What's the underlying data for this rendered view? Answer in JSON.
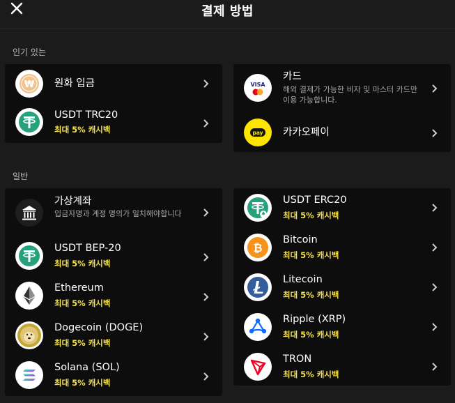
{
  "header": {
    "title": "결제 방법"
  },
  "sections": {
    "popular": "인기 있는",
    "general": "일반"
  },
  "cashback": "최대 5% 캐시백",
  "popular_left": [
    {
      "name": "원화 입금",
      "icon": "won-coin-icon"
    },
    {
      "name": "USDT TRC20",
      "icon": "tether-icon"
    }
  ],
  "popular_right": [
    {
      "name": "카드",
      "desc": "해외 결제가 가능한 비자 및 마스터 카드만 이용 가능합니다.",
      "icon": "visa-mastercard-icon",
      "visa": "VISA"
    },
    {
      "name": "카카오페이",
      "icon": "kakaopay-icon",
      "badge": "pay"
    }
  ],
  "general_left": [
    {
      "name": "가상계좌",
      "desc": "입금자명과 계정 명의가 일치해야합니다",
      "icon": "bank-icon"
    },
    {
      "name": "USDT BEP-20",
      "icon": "tether-icon"
    },
    {
      "name": "Ethereum",
      "icon": "ethereum-icon"
    },
    {
      "name": "Dogecoin (DOGE)",
      "icon": "dogecoin-icon"
    },
    {
      "name": "Solana (SOL)",
      "icon": "solana-icon"
    }
  ],
  "general_right": [
    {
      "name": "USDT ERC20",
      "icon": "tether-erc20-icon"
    },
    {
      "name": "Bitcoin",
      "icon": "bitcoin-icon"
    },
    {
      "name": "Litecoin",
      "icon": "litecoin-icon"
    },
    {
      "name": "Ripple (XRP)",
      "icon": "ripple-icon"
    },
    {
      "name": "TRON",
      "icon": "tron-icon"
    }
  ],
  "colors": {
    "background": "#1b1b1b",
    "card": "#0d0d0d",
    "cashback": "#f4e04a",
    "tether": "#26a17b",
    "bitcoin": "#f7931a",
    "litecoin": "#345d9d",
    "ripple": "#0a6cff",
    "tron": "#ef0027",
    "kakao": "#fee500",
    "won": "#f0c28f"
  }
}
